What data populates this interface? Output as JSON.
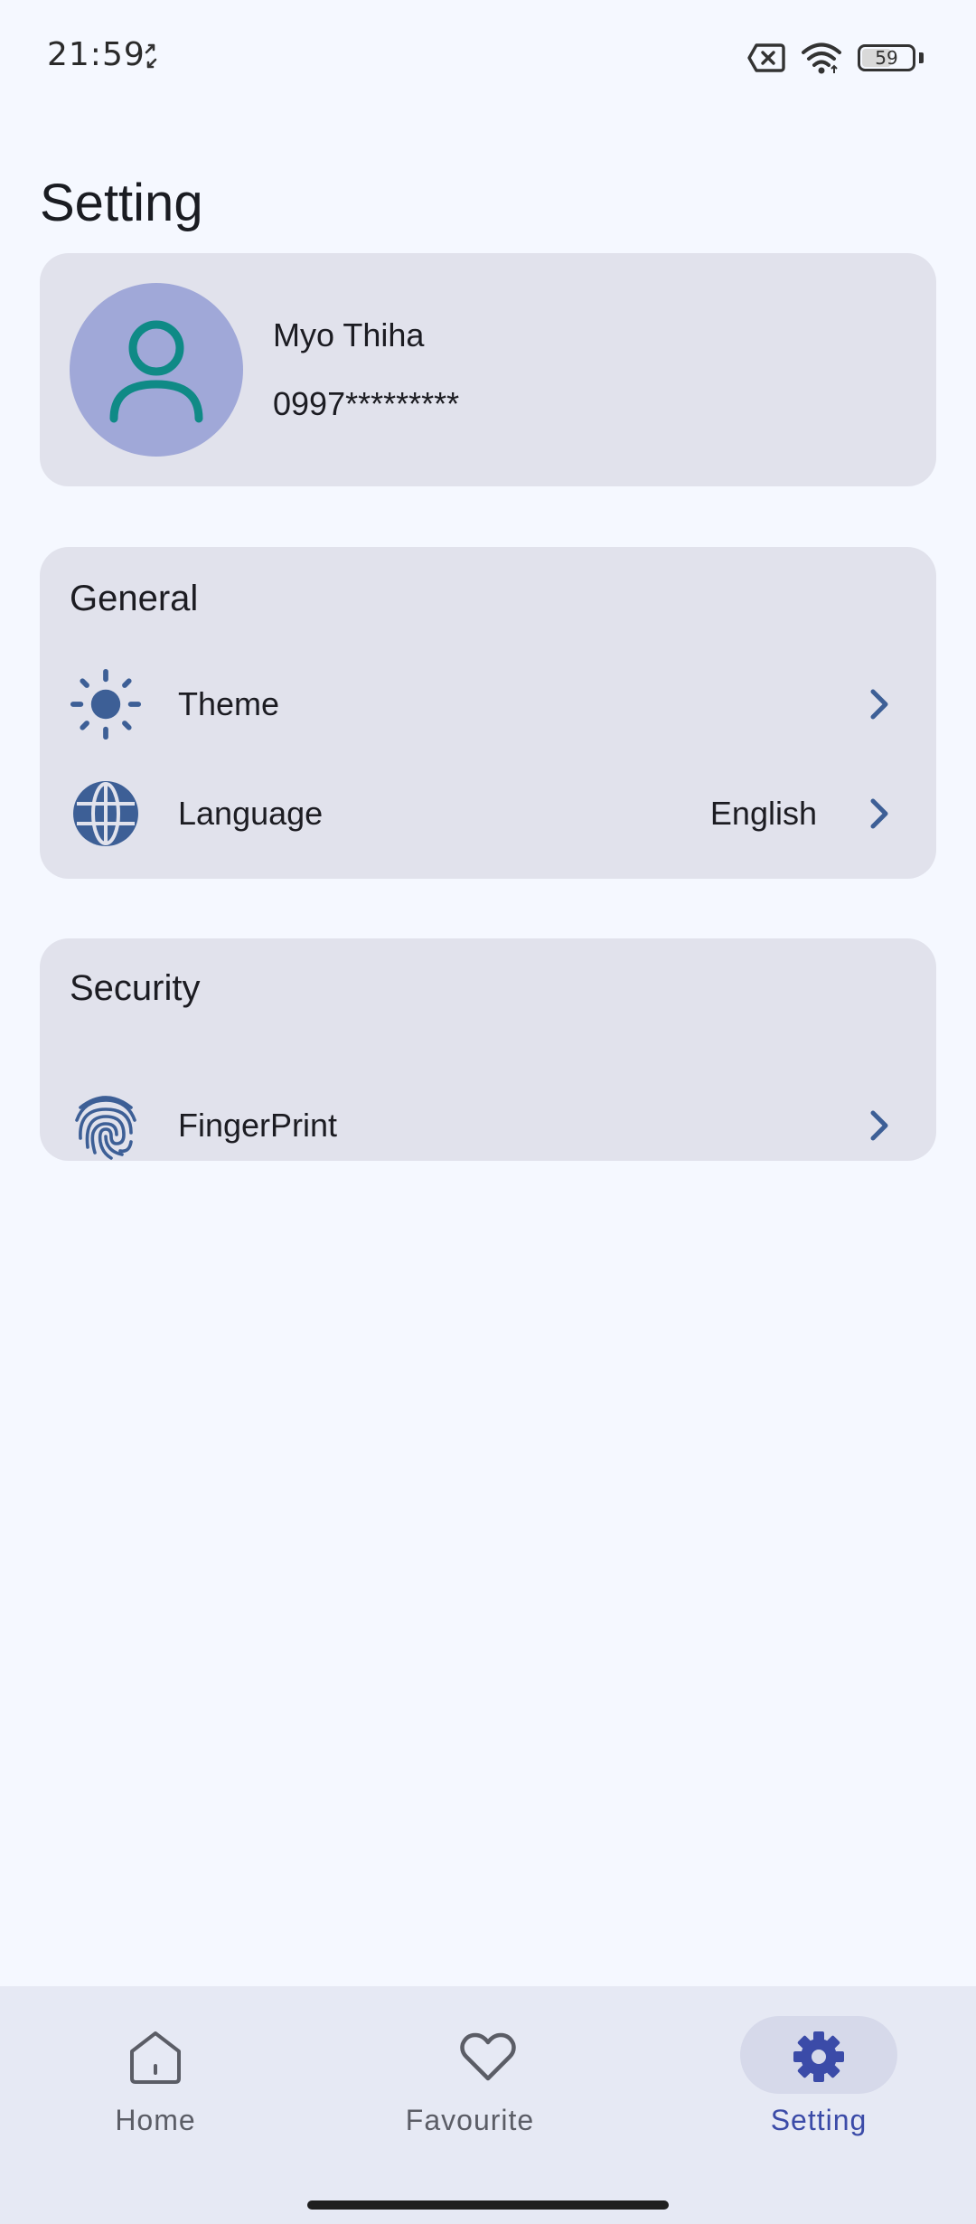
{
  "status_bar": {
    "time": "21:59",
    "battery": "59",
    "battery_level": 0.59,
    "icons": [
      "sync-icon",
      "no-sim-icon",
      "wifi-icon",
      "battery-icon"
    ]
  },
  "page": {
    "title": "Setting"
  },
  "profile": {
    "name": "Myo Thiha",
    "phone": "0997*********",
    "avatar_icon": "person-icon",
    "avatar_bg": "#a0a8d8",
    "avatar_fg": "#0f8a86"
  },
  "general": {
    "title": "General",
    "items": [
      {
        "label": "Theme",
        "icon": "sun-icon",
        "value": ""
      },
      {
        "label": "Language",
        "icon": "globe-icon",
        "value": "English"
      }
    ]
  },
  "security": {
    "title": "Security",
    "items": [
      {
        "label": "FingerPrint",
        "icon": "fingerprint-icon"
      }
    ]
  },
  "bottom_nav": {
    "items": [
      {
        "label": "Home",
        "icon": "home-icon",
        "active": false
      },
      {
        "label": "Favourite",
        "icon": "heart-icon",
        "active": false
      },
      {
        "label": "Setting",
        "icon": "gear-icon",
        "active": true
      }
    ]
  },
  "colors": {
    "background": "#f5f8ff",
    "card": "#e1e2ec",
    "icon_blue": "#3d5f96",
    "active_nav": "#3b4ba8",
    "nav_bg": "#e6e9f4"
  }
}
